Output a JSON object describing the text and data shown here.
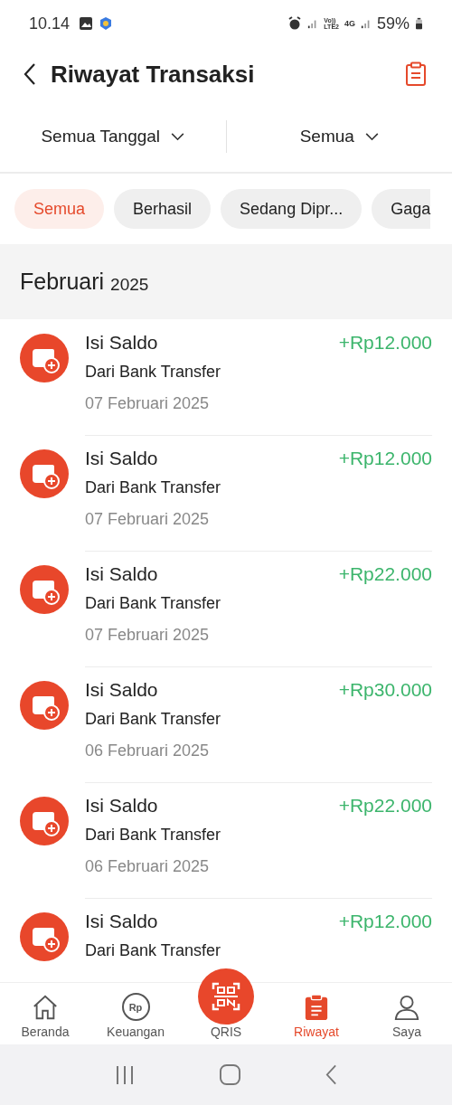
{
  "status_bar": {
    "time": "10.14",
    "battery": "59%",
    "network_top": "Vo))",
    "network_bottom": "LTE2",
    "data_type": "4G"
  },
  "header": {
    "title": "Riwayat Transaksi"
  },
  "filters": [
    {
      "label": "Semua Tanggal"
    },
    {
      "label": "Semua"
    }
  ],
  "chips": [
    {
      "label": "Semua",
      "selected": true
    },
    {
      "label": "Berhasil",
      "selected": false
    },
    {
      "label": "Sedang Dipr...",
      "selected": false
    },
    {
      "label": "Gaga",
      "selected": false
    }
  ],
  "section": {
    "month": "Februari",
    "year": "2025"
  },
  "transactions": [
    {
      "title": "Isi Saldo",
      "source": "Dari Bank Transfer",
      "date": "07 Februari 2025",
      "amount": "+Rp12.000"
    },
    {
      "title": "Isi Saldo",
      "source": "Dari Bank Transfer",
      "date": "07 Februari 2025",
      "amount": "+Rp12.000"
    },
    {
      "title": "Isi Saldo",
      "source": "Dari Bank Transfer",
      "date": "07 Februari 2025",
      "amount": "+Rp22.000"
    },
    {
      "title": "Isi Saldo",
      "source": "Dari Bank Transfer",
      "date": "06 Februari 2025",
      "amount": "+Rp30.000"
    },
    {
      "title": "Isi Saldo",
      "source": "Dari Bank Transfer",
      "date": "06 Februari 2025",
      "amount": "+Rp22.000"
    },
    {
      "title": "Isi Saldo",
      "source": "Dari Bank Transfer",
      "amount": "+Rp12.000"
    }
  ],
  "bottom_nav": [
    {
      "kind": "home",
      "label": "Beranda",
      "selected": false
    },
    {
      "kind": "finance",
      "label": "Keuangan",
      "icon_text": "Rp",
      "selected": false
    },
    {
      "kind": "qris",
      "label": "QRIS",
      "selected": false
    },
    {
      "kind": "history",
      "label": "Riwayat",
      "selected": true
    },
    {
      "kind": "profile",
      "label": "Saya",
      "selected": false
    }
  ]
}
